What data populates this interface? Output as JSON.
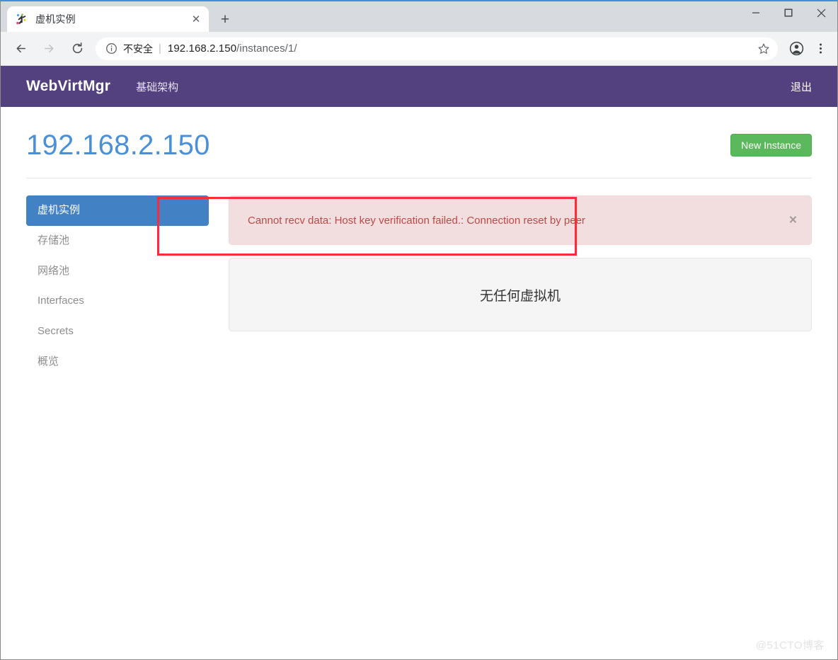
{
  "browser": {
    "tab": {
      "title": "虚机实例",
      "favicon_name": "webvirtmgr-favicon",
      "close_label": "✕"
    },
    "new_tab_label": "+",
    "window_controls": {
      "minimize": "minimize-icon",
      "maximize": "maximize-icon",
      "close": "close-icon"
    },
    "toolbar": {
      "back": "back-arrow-icon",
      "forward": "forward-arrow-icon",
      "reload": "reload-icon",
      "security_icon": "info-circle-icon",
      "security_label": "不安全",
      "separator": "|",
      "url_host": "192.168.2.150",
      "url_path": "/instances/1/",
      "bookmark": "star-icon",
      "profile": "profile-avatar-icon",
      "menu": "three-dot-menu-icon"
    }
  },
  "navbar": {
    "brand": "WebVirtMgr",
    "links": [
      {
        "label": "基础架构"
      }
    ],
    "logout_label": "退出",
    "background": "#53407f"
  },
  "page": {
    "title": "192.168.2.150",
    "title_color": "#4a90d9",
    "new_instance_button": "New Instance",
    "new_instance_color": "#5cb85c"
  },
  "sidebar": {
    "items": [
      {
        "label": "虚机实例",
        "active": true
      },
      {
        "label": "存储池",
        "active": false
      },
      {
        "label": "网络池",
        "active": false
      },
      {
        "label": "Interfaces",
        "active": false
      },
      {
        "label": "Secrets",
        "active": false
      },
      {
        "label": "概览",
        "active": false
      }
    ],
    "active_color": "#4281c4"
  },
  "alert": {
    "message": "Cannot recv data: Host key verification failed.: Connection reset by peer",
    "close_label": "×",
    "background": "#f2dede",
    "text_color": "#b94a48"
  },
  "empty_state": {
    "message": "无任何虚拟机"
  },
  "annotation": {
    "color": "#fb2c36"
  },
  "watermark": {
    "text": "@51CTO博客"
  }
}
